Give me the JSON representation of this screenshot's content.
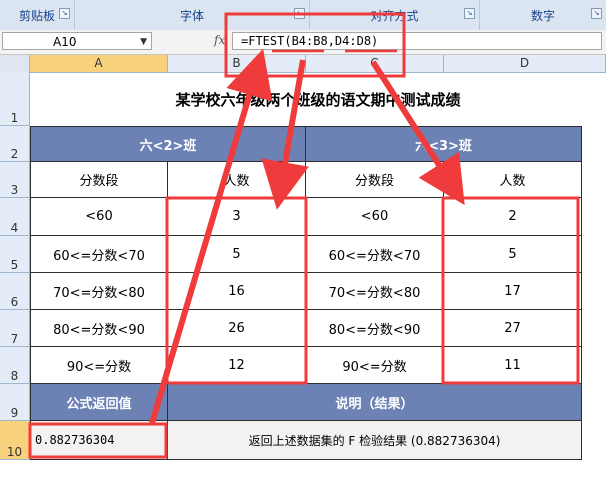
{
  "ribbon": {
    "groups": [
      "剪贴板",
      "字体",
      "对齐方式",
      "数字"
    ]
  },
  "formula_bar": {
    "name_box": "A10",
    "fx_label": "fx",
    "formula": "=FTEST(B4:B8,D4:D8)"
  },
  "columns": [
    "A",
    "B",
    "C",
    "D"
  ],
  "rows": [
    "1",
    "2",
    "3",
    "4",
    "5",
    "6",
    "7",
    "8",
    "9",
    "10"
  ],
  "sheet": {
    "title": "某学校六年级两个班级的语文期中测试成绩",
    "class1_header": "六<2>班",
    "class2_header": "六<3>班",
    "col_range": "分数段",
    "col_count": "人数",
    "ranges": [
      "<60",
      "60<=分数<70",
      "70<=分数<80",
      "80<=分数<90",
      "90<=分数"
    ],
    "class1_counts": [
      "3",
      "5",
      "16",
      "26",
      "12"
    ],
    "class2_counts": [
      "2",
      "5",
      "17",
      "27",
      "11"
    ],
    "formula_header": "公式返回值",
    "desc_header": "说明（结果）",
    "result_value": "0.882736304",
    "result_desc": "返回上述数据集的 F 检验结果 (0.882736304)"
  },
  "colors": {
    "header_blue": "#6d82b4",
    "highlight_red": "#ef3b3b",
    "selected_header": "#f8d17d"
  }
}
